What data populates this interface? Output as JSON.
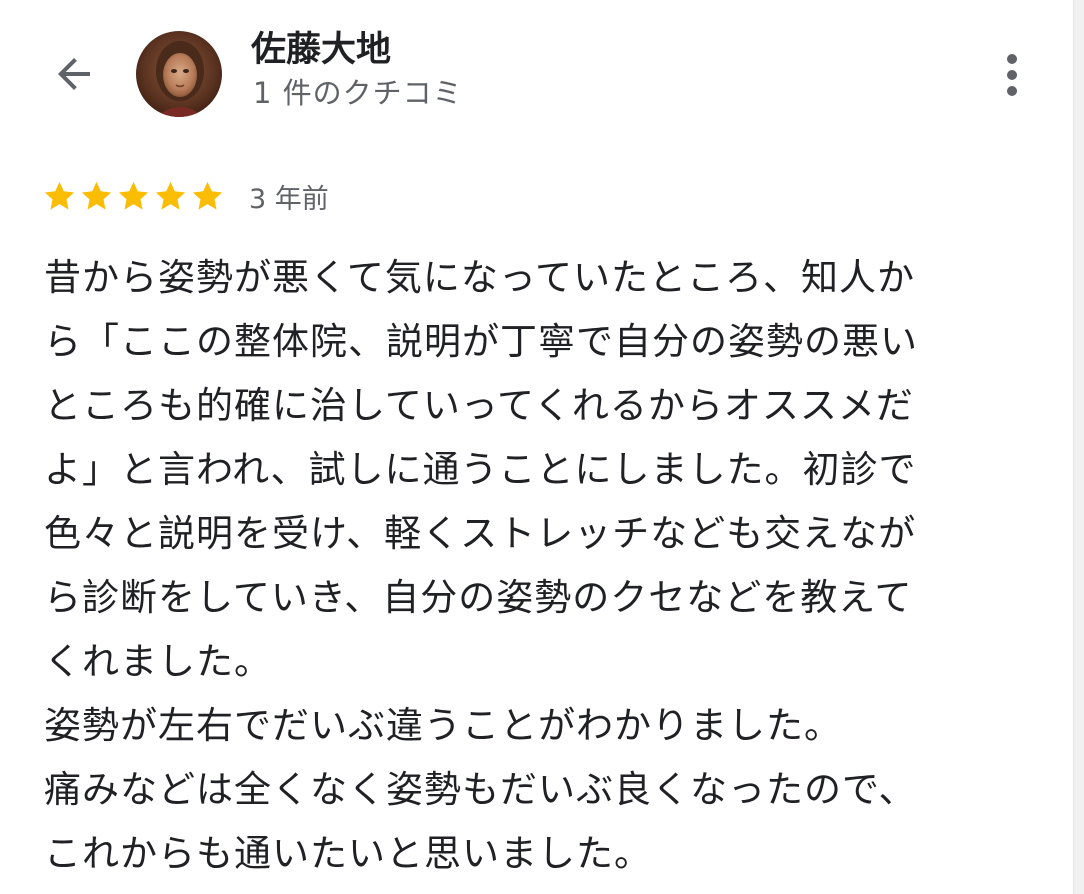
{
  "header": {
    "back_icon": "arrow-left-icon",
    "user_name": "佐藤大地",
    "review_count": "1 件のクチコミ",
    "more_icon": "more-vert-icon"
  },
  "review": {
    "rating": 5,
    "rating_max": 5,
    "star_color": "#FBBC04",
    "time_ago": "3 年前",
    "lines": [
      "昔から姿勢が悪くて気になっていたところ、知人か",
      "ら「ここの整体院、説明が丁寧で自分の姿勢の悪い",
      "ところも的確に治していってくれるからオススメだ",
      "よ」と言われ、試しに通うことにしました。初診で",
      "色々と説明を受け、軽くストレッチなども交えなが",
      "ら診断をしていき、自分の姿勢のクセなどを教えて",
      "くれました。",
      "姿勢が左右でだいぶ違うことがわかりました。",
      "痛みなどは全くなく姿勢もだいぶ良くなったので、",
      "これからも通いたいと思いました。"
    ]
  }
}
